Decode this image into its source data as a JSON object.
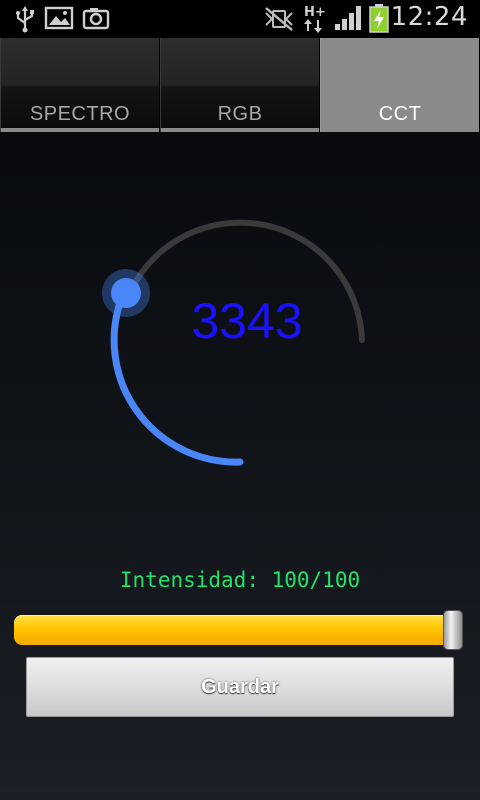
{
  "status_bar": {
    "time": "12:24",
    "network_type": "H+",
    "icons": [
      "usb-icon",
      "gallery-icon",
      "camera-icon",
      "nfc-muted-icon",
      "data-transfer-icon",
      "signal-icon",
      "battery-charging-icon"
    ]
  },
  "tabs": [
    {
      "label": "SPECTRO",
      "active": false
    },
    {
      "label": "RGB",
      "active": false
    },
    {
      "label": "CCT",
      "active": true
    }
  ],
  "dial": {
    "value": "3343",
    "value_color": "#1a12ff",
    "track_color": "#3a3a3a",
    "progress_color": "#4a86f7"
  },
  "intensity": {
    "label": "Intensidad: 100/100",
    "value": 100,
    "max": 100,
    "label_color": "#1fe36a",
    "bar_color": "#ffc400"
  },
  "save_button": {
    "label": "Guardar"
  }
}
